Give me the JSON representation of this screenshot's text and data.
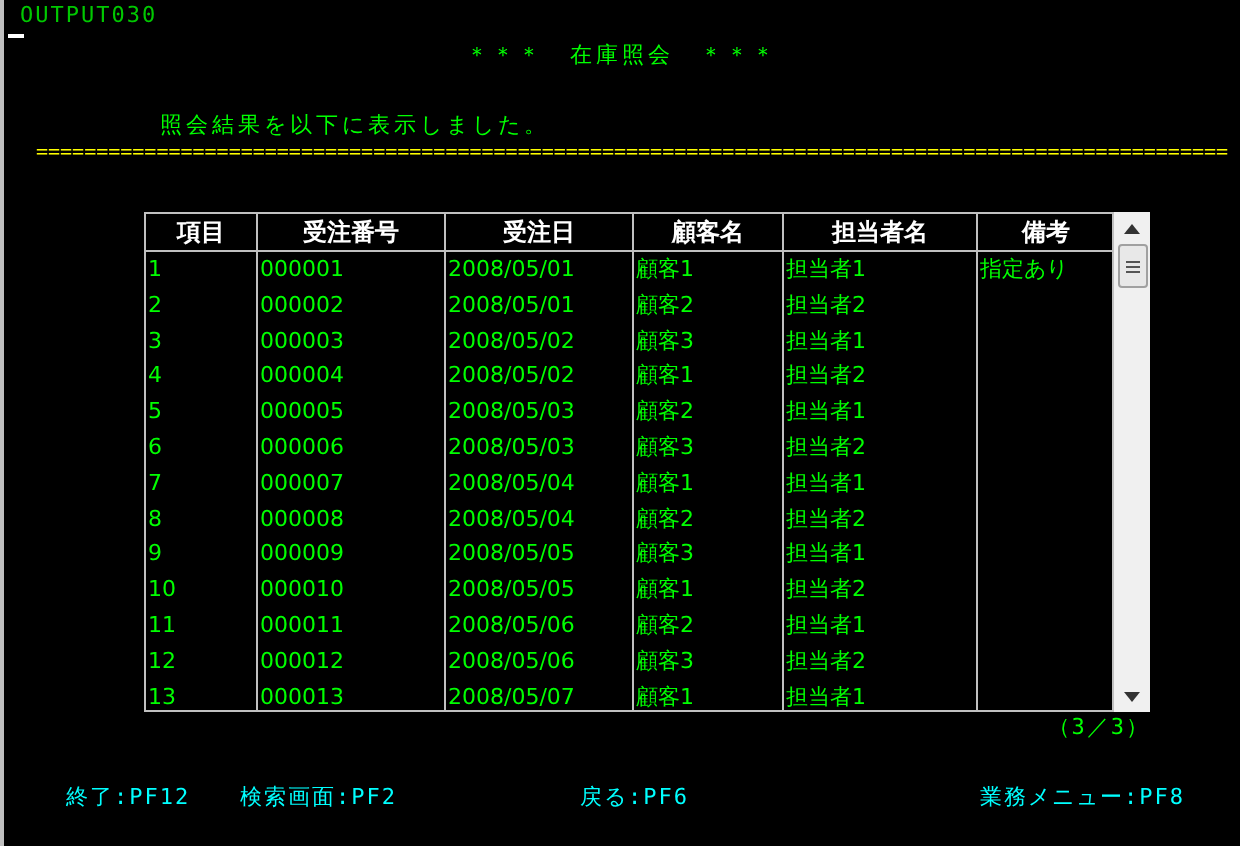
{
  "screen_id": "OUTPUT030",
  "title": "＊＊＊　在庫照会　＊＊＊",
  "message": "照会結果を以下に表示しました。",
  "separator": "===================================================================================================",
  "table": {
    "columns": [
      "項目",
      "受注番号",
      "受注日",
      "顧客名",
      "担当者名",
      "備考"
    ],
    "rows": [
      {
        "item": "1",
        "order_no": "000001",
        "order_date": "2008/05/01",
        "customer": "顧客1",
        "staff": "担当者1",
        "remarks": "指定あり"
      },
      {
        "item": "2",
        "order_no": "000002",
        "order_date": "2008/05/01",
        "customer": "顧客2",
        "staff": "担当者2"
      },
      {
        "item": "3",
        "order_no": "000003",
        "order_date": "2008/05/02",
        "customer": "顧客3",
        "staff": "担当者1"
      },
      {
        "item": "4",
        "order_no": "000004",
        "order_date": "2008/05/02",
        "customer": "顧客1",
        "staff": "担当者2"
      },
      {
        "item": "5",
        "order_no": "000005",
        "order_date": "2008/05/03",
        "customer": "顧客2",
        "staff": "担当者1"
      },
      {
        "item": "6",
        "order_no": "000006",
        "order_date": "2008/05/03",
        "customer": "顧客3",
        "staff": "担当者2"
      },
      {
        "item": "7",
        "order_no": "000007",
        "order_date": "2008/05/04",
        "customer": "顧客1",
        "staff": "担当者1"
      },
      {
        "item": "8",
        "order_no": "000008",
        "order_date": "2008/05/04",
        "customer": "顧客2",
        "staff": "担当者2"
      },
      {
        "item": "9",
        "order_no": "000009",
        "order_date": "2008/05/05",
        "customer": "顧客3",
        "staff": "担当者1"
      },
      {
        "item": "10",
        "order_no": "000010",
        "order_date": "2008/05/05",
        "customer": "顧客1",
        "staff": "担当者2"
      },
      {
        "item": "11",
        "order_no": "000011",
        "order_date": "2008/05/06",
        "customer": "顧客2",
        "staff": "担当者1"
      },
      {
        "item": "12",
        "order_no": "000012",
        "order_date": "2008/05/06",
        "customer": "顧客3",
        "staff": "担当者2"
      },
      {
        "item": "13",
        "order_no": "000013",
        "order_date": "2008/05/07",
        "customer": "顧客1",
        "staff": "担当者1"
      }
    ]
  },
  "page_indicator": "（3／3）",
  "function_keys": [
    "終了:PF12",
    "検索画面:PF2",
    "戻る:PF6",
    "業務メニュー:PF8"
  ]
}
